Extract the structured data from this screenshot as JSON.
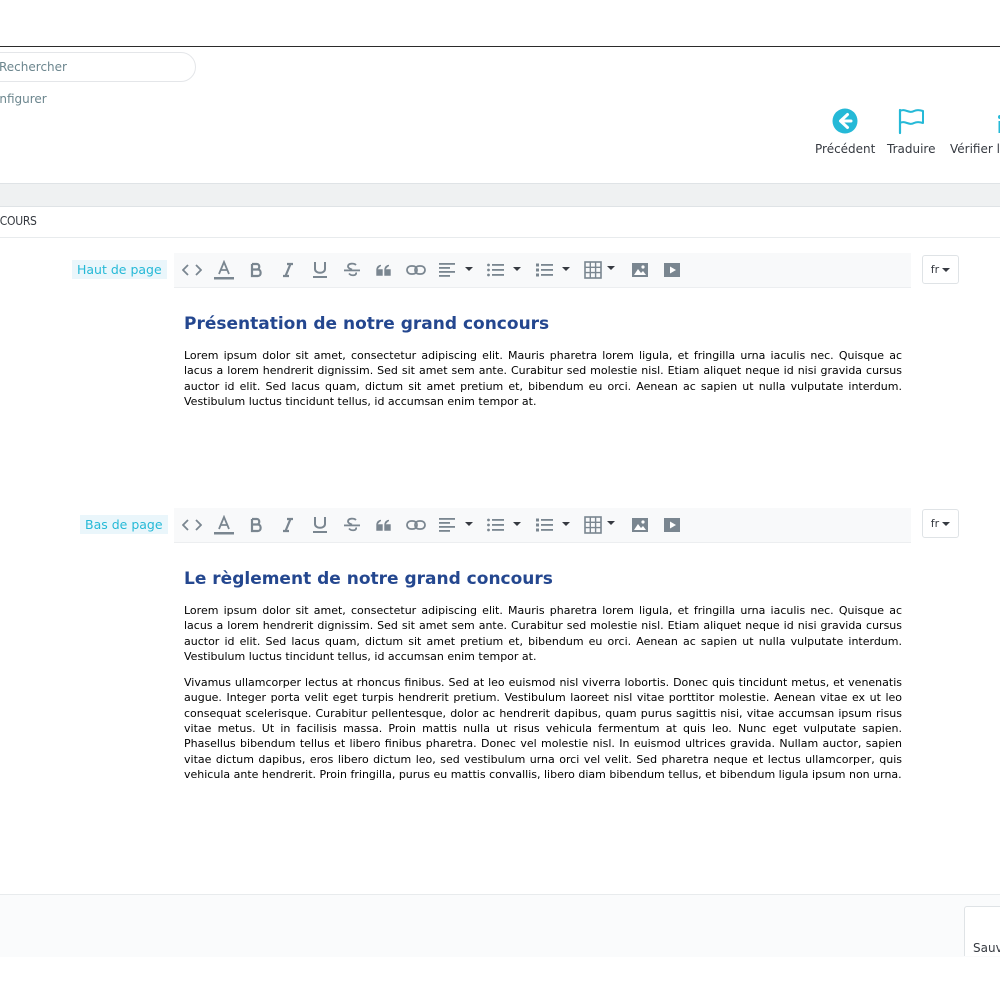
{
  "search": {
    "placeholder": "Rechercher"
  },
  "breadcrumb": {
    "current": "onfigurer"
  },
  "toolbar": {
    "previous_label": "Précédent",
    "translate_label": "Traduire",
    "verify_label": "Vérifier la"
  },
  "panel": {
    "title": "NCOURS"
  },
  "header_section": {
    "label": "Haut de page",
    "language": "fr",
    "heading": "Présentation de notre grand concours",
    "paragraphs": [
      "Lorem ipsum dolor sit amet, consectetur adipiscing elit. Mauris pharetra lorem ligula, et fringilla urna iaculis nec. Quisque ac lacus a lorem hendrerit dignissim. Sed sit amet sem ante. Curabitur sed molestie nisl. Etiam aliquet neque id nisi gravida cursus auctor id elit. Sed lacus quam, dictum sit amet pretium et, bibendum eu orci. Aenean ac sapien ut nulla vulputate interdum. Vestibulum luctus tincidunt tellus, id accumsan enim tempor at."
    ]
  },
  "footer_section": {
    "label": "Bas de page",
    "language": "fr",
    "heading": "Le règlement de notre grand concours",
    "paragraphs": [
      "Lorem ipsum dolor sit amet, consectetur adipiscing elit. Mauris pharetra lorem ligula, et fringilla urna iaculis nec. Quisque ac lacus a lorem hendrerit dignissim. Sed sit amet sem ante. Curabitur sed molestie nisl. Etiam aliquet neque id nisi gravida cursus auctor id elit. Sed lacus quam, dictum sit amet pretium et, bibendum eu orci. Aenean ac sapien ut nulla vulputate interdum. Vestibulum luctus tincidunt tellus, id accumsan enim tempor at.",
      "Vivamus ullamcorper lectus at rhoncus finibus. Sed at leo euismod nisl viverra lobortis. Donec quis tincidunt metus, et venenatis augue. Integer porta velit eget turpis hendrerit pretium. Vestibulum laoreet nisl vitae porttitor molestie. Aenean vitae ex ut leo consequat scelerisque. Curabitur pellentesque, dolor ac hendrerit dapibus, quam purus sagittis nisi, vitae accumsan ipsum risus vitae metus. Ut in facilisis massa. Proin mattis nulla ut risus vehicula fermentum at quis leo. Nunc eget vulputate sapien. Phasellus bibendum tellus et libero finibus pharetra. Donec vel molestie nisl. In euismod ultrices gravida. Nullam auctor, sapien vitae dictum dapibus, eros libero dictum leo, sed vestibulum urna orci vel velit. Sed pharetra neque et lectus ullamcorper, quis vehicula ante hendrerit. Proin fringilla, purus eu mattis convallis, libero diam bibendum tellus, et bibendum ligula ipsum non urna."
    ]
  },
  "footer": {
    "save_label": "Sauvegarder"
  },
  "colors": {
    "accent": "#25b9d7",
    "heading": "#24478f",
    "icon_gray": "#7a8690"
  },
  "icons": {
    "previous": "arrow-left-circle-icon",
    "translate": "flag-icon",
    "code": "code-icon",
    "font_color": "font-color-icon",
    "bold": "bold-icon",
    "italic": "italic-icon",
    "underline": "underline-icon",
    "strikethrough": "strikethrough-icon",
    "quote": "quote-icon",
    "link": "link-icon",
    "align": "align-left-icon",
    "unordered_list": "list-ul-icon",
    "ordered_list": "list-ol-icon",
    "table": "table-icon",
    "image": "image-icon",
    "video": "video-icon"
  }
}
